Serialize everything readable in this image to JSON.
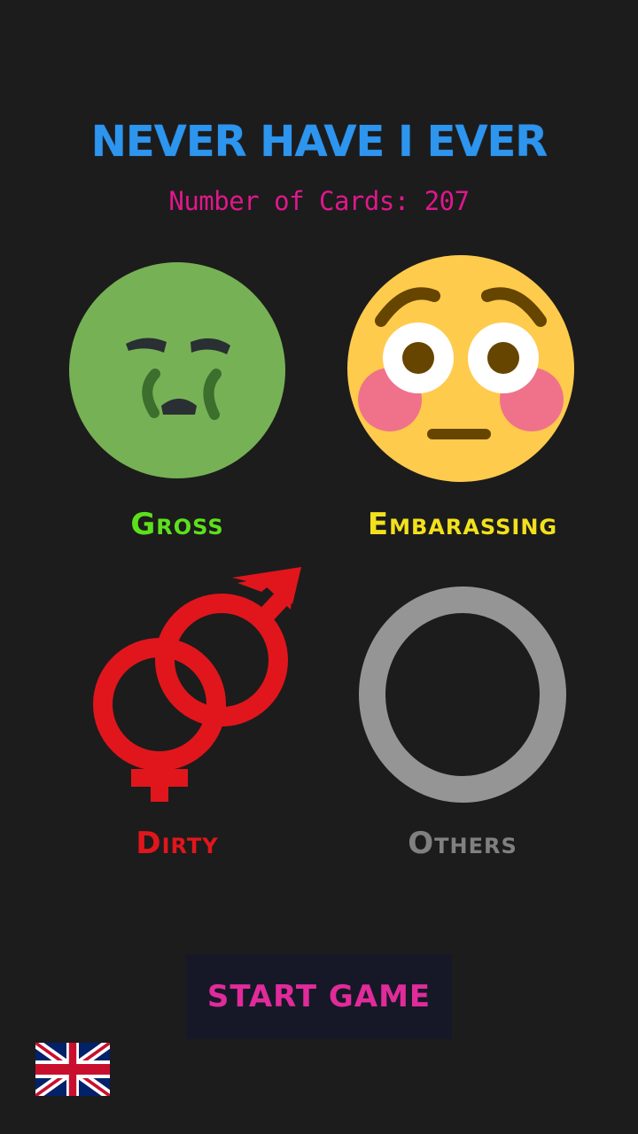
{
  "header": {
    "title": "NEVER HAVE I EVER",
    "card_count_text": "Number of Cards: 207"
  },
  "categories": [
    {
      "id": "gross",
      "label": "Gross",
      "icon": "nauseated-face-icon",
      "color": "#5de01c"
    },
    {
      "id": "embarassing",
      "label": "Embarassing",
      "icon": "flushed-face-icon",
      "color": "#f2e11b"
    },
    {
      "id": "dirty",
      "label": "Dirty",
      "icon": "male-female-symbol-icon",
      "color": "#e0161c"
    },
    {
      "id": "others",
      "label": "Others",
      "icon": "letter-o-icon",
      "color": "#808080"
    }
  ],
  "footer": {
    "start_label": "START GAME",
    "language_icon": "uk-flag-icon"
  },
  "colors": {
    "background": "#1c1c1c",
    "title": "#2e95ee",
    "count": "#e0178c",
    "start_button_bg": "#161827",
    "start_button_text": "#e12b9a"
  }
}
